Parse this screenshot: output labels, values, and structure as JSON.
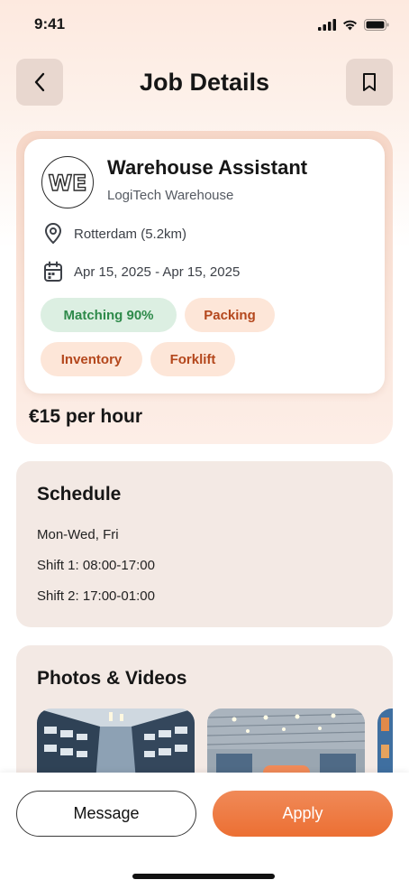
{
  "status": {
    "time": "9:41"
  },
  "header": {
    "title": "Job Details"
  },
  "job": {
    "logo_text": "WE",
    "title": "Warehouse Assistant",
    "company": "LogiTech Warehouse",
    "location": "Rotterdam (5.2km)",
    "dates": "Apr 15, 2025 - Apr 15, 2025",
    "tags": [
      "Matching 90%",
      "Packing",
      "Inventory",
      "Forklift"
    ],
    "pay": "€15 per hour"
  },
  "schedule": {
    "title": "Schedule",
    "lines": [
      "Mon-Wed, Fri",
      "Shift 1: 08:00-17:00",
      "Shift 2: 17:00-01:00"
    ]
  },
  "photos": {
    "title": "Photos & Videos"
  },
  "actions": {
    "message": "Message",
    "apply": "Apply"
  },
  "colors": {
    "accent": "#ec6f33",
    "match_tag_bg": "#dcefe2",
    "match_tag_text": "#2e8a4a",
    "skill_tag_bg": "#fde6d8",
    "skill_tag_text": "#b4471c"
  }
}
